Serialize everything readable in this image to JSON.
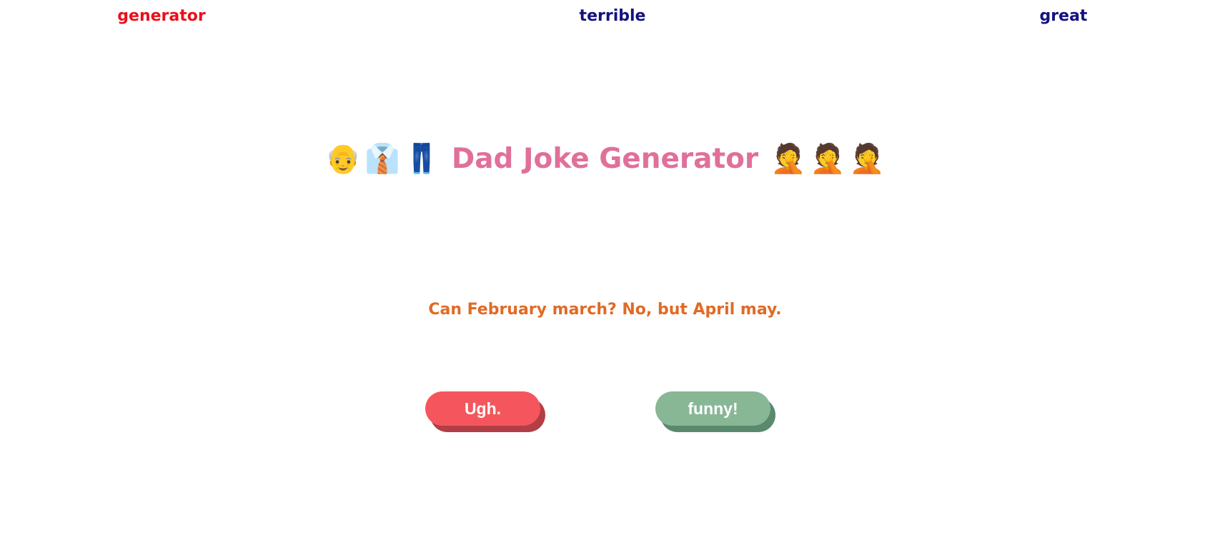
{
  "nav": {
    "items": [
      {
        "label": "generator",
        "active": true,
        "color": "#e8101c"
      },
      {
        "label": "terrible",
        "active": false,
        "color": "#14127e"
      },
      {
        "label": "great",
        "active": false,
        "color": "#14127e"
      }
    ]
  },
  "header": {
    "leading_emojis": [
      "👴",
      "👔",
      "👖"
    ],
    "title": "Dad Joke Generator",
    "trailing_emojis": [
      "🤦",
      "🤦",
      "🤦"
    ],
    "title_color": "#e0709a"
  },
  "joke": {
    "text": "Can February march? No, but April may.",
    "color": "#e06a25"
  },
  "buttons": {
    "ugh_label": "Ugh.",
    "funny_label": "funny!",
    "ugh_color": "#f5565d",
    "funny_color": "#88b795"
  }
}
